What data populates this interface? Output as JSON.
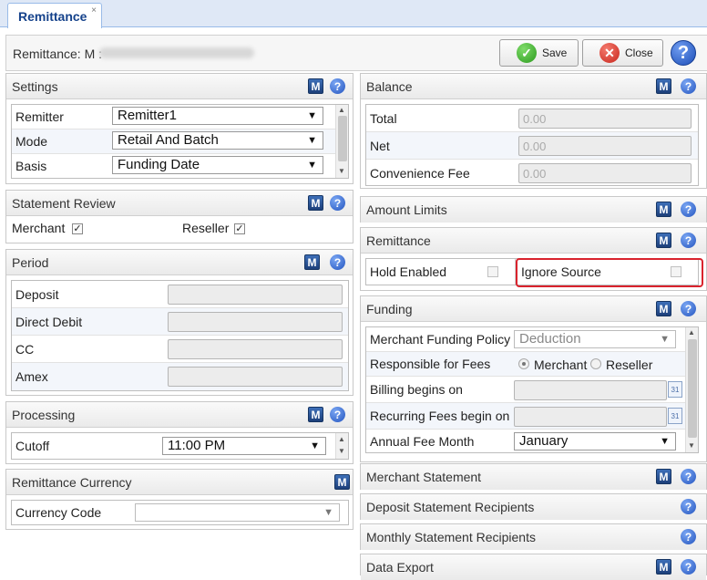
{
  "tab": {
    "label": "Remittance",
    "close": "×"
  },
  "header": {
    "label": "Remittance: M :",
    "save": "Save",
    "close": "Close",
    "help": "?"
  },
  "icons": {
    "m": "M",
    "help": "?"
  },
  "settings": {
    "title": "Settings",
    "rows": [
      {
        "label": "Remitter",
        "value": "Remitter1"
      },
      {
        "label": "Mode",
        "value": "Retail And Batch"
      },
      {
        "label": "Basis",
        "value": "Funding Date"
      }
    ]
  },
  "statement_review": {
    "title": "Statement Review",
    "merchant_label": "Merchant",
    "merchant_checked": true,
    "reseller_label": "Reseller",
    "reseller_checked": true
  },
  "period": {
    "title": "Period",
    "rows": [
      {
        "label": "Deposit"
      },
      {
        "label": "Direct Debit"
      },
      {
        "label": "CC"
      },
      {
        "label": "Amex"
      }
    ]
  },
  "processing": {
    "title": "Processing",
    "cutoff_label": "Cutoff",
    "cutoff_value": "11:00 PM"
  },
  "remittance_currency": {
    "title": "Remittance Currency",
    "currency_label": "Currency Code",
    "currency_value": ""
  },
  "balance": {
    "title": "Balance",
    "rows": [
      {
        "label": "Total",
        "value": "0.00"
      },
      {
        "label": "Net",
        "value": "0.00"
      },
      {
        "label": "Convenience Fee",
        "value": "0.00"
      }
    ]
  },
  "amount_limits": {
    "title": "Amount Limits"
  },
  "remittance": {
    "title": "Remittance",
    "hold_label": "Hold Enabled",
    "hold_checked": false,
    "ignore_label": "Ignore Source",
    "ignore_checked": false
  },
  "funding": {
    "title": "Funding",
    "policy_label": "Merchant Funding Policy",
    "policy_value": "Deduction",
    "responsible_label": "Responsible for Fees",
    "opt_merchant": "Merchant",
    "opt_reseller": "Reseller",
    "billing_label": "Billing begins on",
    "recurring_label": "Recurring Fees begin on",
    "annual_label": "Annual Fee Month",
    "annual_value": "January"
  },
  "sections": {
    "merchant_statement": "Merchant Statement",
    "deposit_recipients": "Deposit Statement Recipients",
    "monthly_recipients": "Monthly Statement Recipients",
    "data_export": "Data Export"
  },
  "colors": {
    "highlight": "#d9232d",
    "accent": "#15428b"
  }
}
